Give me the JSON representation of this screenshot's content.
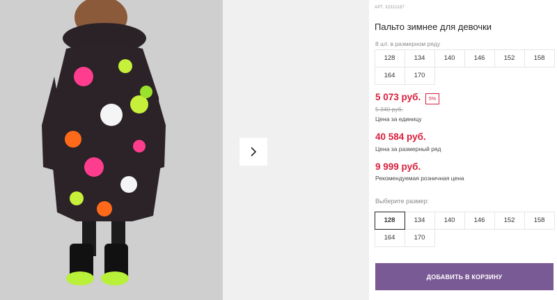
{
  "product": {
    "sku": "АРТ. 32321187",
    "title": "Пальто зимнее для девочки"
  },
  "size_row_info": {
    "note": "8 шт. в размерном ряду",
    "sizes": [
      "128",
      "134",
      "140",
      "146",
      "152",
      "158",
      "164",
      "170"
    ]
  },
  "prices": {
    "unit_price": "5 073 руб.",
    "discount": "5%",
    "old_price": "5 340 руб.",
    "unit_caption": "Цена за единицу",
    "row_price": "40 584 руб.",
    "row_caption": "Цена за размерный ряд",
    "rrp_price": "9 999 руб.",
    "rrp_caption": "Рекомендуемая розничная цена"
  },
  "size_select": {
    "label": "Выберите размер:",
    "sizes": [
      "128",
      "134",
      "140",
      "146",
      "152",
      "158",
      "164",
      "170"
    ],
    "selected": "128"
  },
  "cart": {
    "add_label": "ДОБАВИТЬ В КОРЗИНУ"
  },
  "colors": {
    "accent": "#7a5a95",
    "price_red": "#d81f3c"
  },
  "icons": {
    "next": "chevron-right-icon"
  }
}
